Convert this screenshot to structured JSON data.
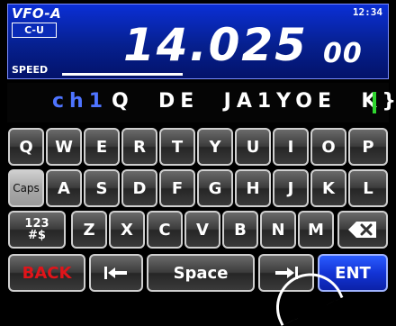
{
  "header": {
    "vfo": "VFO-A",
    "mode": "C-U",
    "clock": "12:34",
    "freq_main": "14.025",
    "freq_sub": "00",
    "speed_label": "SPEED"
  },
  "text_line": {
    "channel": "ch1",
    "message": "Q  DE  JA1YOE  K}"
  },
  "keyboard": {
    "row1": [
      "Q",
      "W",
      "E",
      "R",
      "T",
      "Y",
      "U",
      "I",
      "O",
      "P"
    ],
    "row2": [
      "Caps",
      "A",
      "S",
      "D",
      "F",
      "G",
      "H",
      "J",
      "K",
      "L"
    ],
    "row3_symbol": "123\n#$",
    "row3": [
      "Z",
      "X",
      "C",
      "V",
      "B",
      "N",
      "M"
    ],
    "backspace_icon": "backspace-icon",
    "back": "BACK",
    "left_arrow": "|◀",
    "space": "Space",
    "right_arrow": "▶|",
    "enter": "ENT"
  },
  "colors": {
    "header_blue": "#0b2fd6",
    "channel_blue": "#4e74ff",
    "cursor_green": "#2fd62f",
    "back_red": "#e0141a",
    "ent_blue": "#1334d6"
  }
}
